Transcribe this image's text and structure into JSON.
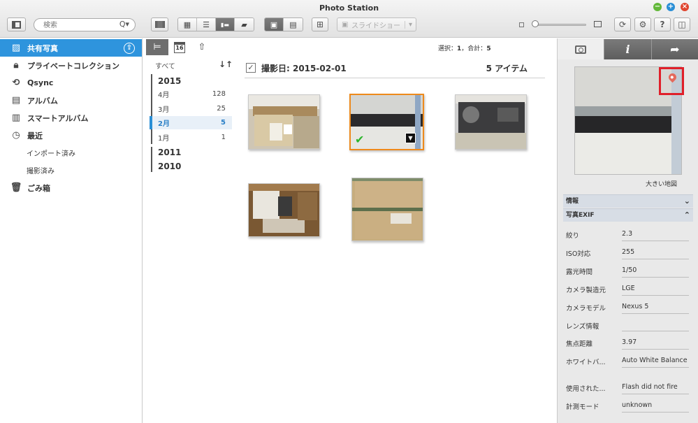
{
  "app": {
    "title": "Photo Station"
  },
  "toolbar": {
    "search_placeholder": "検索",
    "slideshow_label": "スライドショー"
  },
  "sidebar": {
    "items": [
      {
        "label": "共有写真",
        "icon": "image-icon",
        "selected": true
      },
      {
        "label": "プライベートコレクション",
        "icon": "lock-icon"
      },
      {
        "label": "Qsync",
        "icon": "sync-icon"
      },
      {
        "label": "アルバム",
        "icon": "album-icon"
      },
      {
        "label": "スマートアルバム",
        "icon": "smart-album-icon"
      },
      {
        "label": "最近",
        "icon": "clock-icon"
      },
      {
        "label": "インポート済み"
      },
      {
        "label": "撮影済み"
      },
      {
        "label": "ごみ箱",
        "icon": "trash-icon"
      }
    ]
  },
  "datecol": {
    "all_label": "すべて",
    "calendar_day": "16",
    "years": [
      "2015",
      "2011",
      "2010"
    ],
    "months": [
      {
        "label": "4月",
        "count": "128"
      },
      {
        "label": "3月",
        "count": "25"
      },
      {
        "label": "2月",
        "count": "5",
        "selected": true
      },
      {
        "label": "1月",
        "count": "1"
      }
    ]
  },
  "main": {
    "status_selected_label": "選択：",
    "status_selected": "1",
    "status_total_label": "合計：",
    "status_total": "5",
    "group_title": "撮影日: 2015-02-01",
    "group_count": "5 アイテム"
  },
  "rpanel": {
    "map_link": "大きい地図",
    "info_section": "情報",
    "exif_section": "写真EXIF",
    "exif": [
      {
        "key": "絞り",
        "value": "2.3"
      },
      {
        "key": "ISO対応",
        "value": "255"
      },
      {
        "key": "露光時間",
        "value": "1/50"
      },
      {
        "key": "カメラ製造元",
        "value": "LGE"
      },
      {
        "key": "カメラモデル",
        "value": "Nexus 5"
      },
      {
        "key": "レンズ情報",
        "value": ""
      },
      {
        "key": "焦点距離",
        "value": "3.97"
      },
      {
        "key": "ホワイトバ...",
        "value": "Auto White Balance"
      },
      {
        "key": "使用された...",
        "value": "Flash did not fire"
      },
      {
        "key": "計測モード",
        "value": "unknown"
      }
    ]
  }
}
